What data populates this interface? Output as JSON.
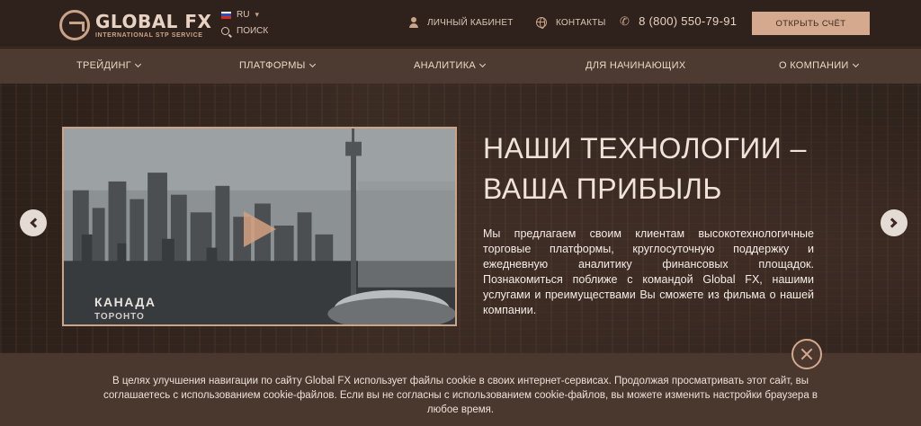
{
  "header": {
    "logo": {
      "name": "GLOBAL FX",
      "tagline": "INTERNATIONAL STP SERVICE"
    },
    "language": {
      "selected": "RU",
      "flag": "russia-flag"
    },
    "search_label": "ПОИСК",
    "account_label": "ЛИЧНЫЙ КАБИНЕТ",
    "contacts_label": "КОНТАКТЫ",
    "phone": "8 (800) 550-79-91",
    "cta_label": "ОТКРЫТЬ СЧЁТ",
    "cta_color": "#d4a98d"
  },
  "nav": {
    "items": [
      {
        "label": "ТРЕЙДИНГ",
        "dropdown": true
      },
      {
        "label": "ПЛАТФОРМЫ",
        "dropdown": true
      },
      {
        "label": "АНАЛИТИКА",
        "dropdown": true
      },
      {
        "label": "ДЛЯ НАЧИНАЮЩИХ",
        "dropdown": false
      },
      {
        "label": "О КОМПАНИИ",
        "dropdown": true
      }
    ]
  },
  "hero": {
    "video": {
      "country": "КАНАДА",
      "city": "ТОРОНТО"
    },
    "title_line1": "НАШИ ТЕХНОЛОГИИ –",
    "title_line2": "ВАША ПРИБЫЛЬ",
    "text": "Мы предлагаем своим клиентам высокотехнологичные торговые платформы, круглосуточную поддержку и ежедневную аналитику финансовых площадок. Познакомиться поближе с командой Global FX, нашими услугами и преимуществами Вы сможете из фильма о нашей компании."
  },
  "cookie": {
    "text": "В целях улучшения навигации по сайту Global FX использует файлы cookie в своих интернет-сервисах. Продолжая просматривать этот сайт, вы соглашаетесь с использованием cookie-файлов. Если вы не согласны с использованием cookie-файлов, вы можете изменить настройки браузера в любое время."
  },
  "colors": {
    "topbar_bg": "#2f221c",
    "nav_bg": "#4d3a30",
    "accent": "#c9a488"
  }
}
